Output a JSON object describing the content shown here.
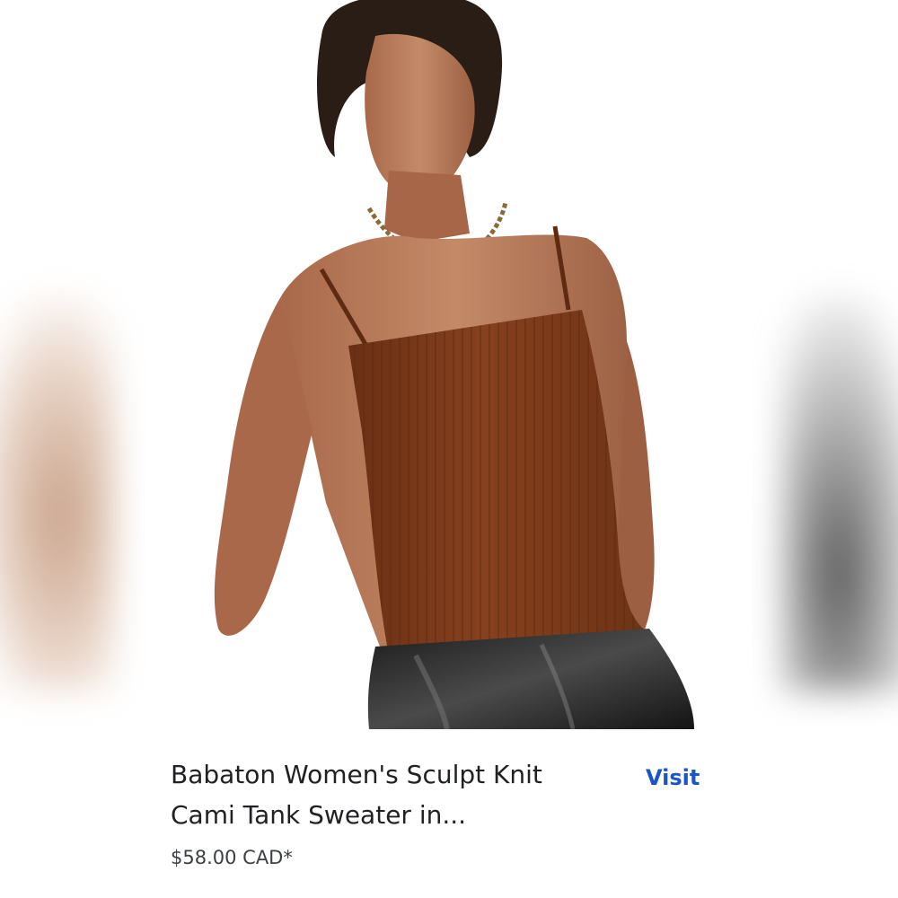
{
  "product": {
    "title_line1": "Babaton Women's Sculpt Knit",
    "title_line2": "Cami Tank Sweater in...",
    "price": "$58.00 CAD*",
    "visit_label": "Visit",
    "image_description_icon": "product-photo"
  },
  "colors": {
    "link": "#1a56c6",
    "title": "#202124",
    "price": "#3c4043",
    "garment": "#7a3a1a"
  }
}
